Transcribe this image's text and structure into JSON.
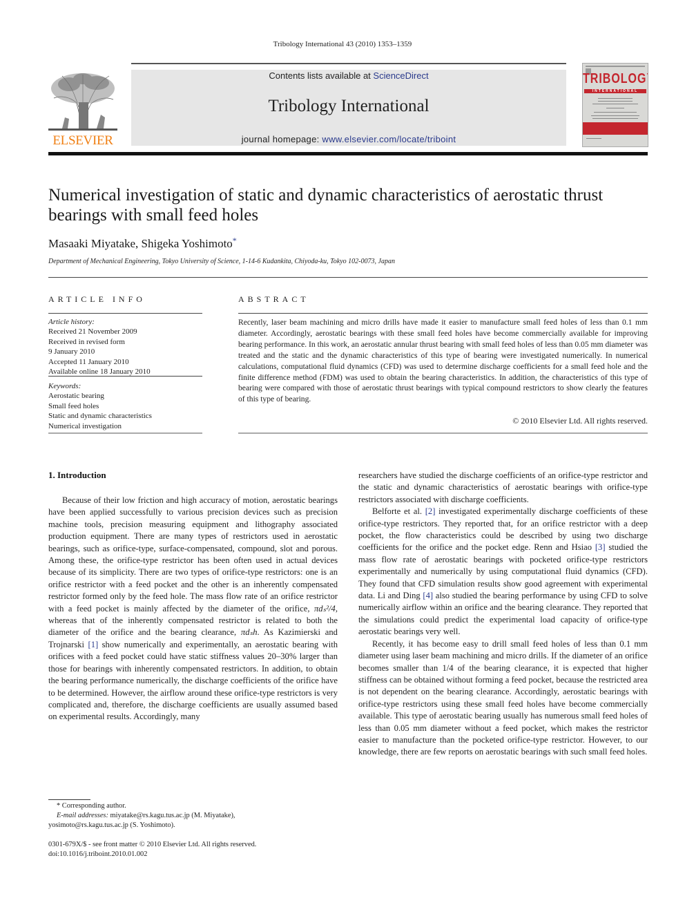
{
  "running_header": "Tribology International 43 (2010) 1353–1359",
  "masthead": {
    "contents_prefix": "Contents lists available at ",
    "contents_link": "ScienceDirect",
    "journal_title": "Tribology International",
    "homepage_prefix": "journal homepage: ",
    "homepage_link": "www.elsevier.com/locate/triboint",
    "publisher_logo_text": "ELSEVIER",
    "cover": {
      "title": "TRIBOLOGY",
      "subtitle": "INTERNATIONAL"
    },
    "colors": {
      "publisher_orange": "#f07f13",
      "link_blue": "#2a3a8c",
      "cover_red": "#c4262e",
      "masthead_grey": "#e6e6e6"
    }
  },
  "article": {
    "title": "Numerical investigation of static and dynamic characteristics of aerostatic thrust bearings with small feed holes",
    "authors": "Masaaki Miyatake, Shigeka Yoshimoto",
    "corresponding_mark": "*",
    "affiliation": "Department of Mechanical Engineering, Tokyo University of Science, 1-14-6 Kudankita, Chiyoda-ku, Tokyo 102-0073, Japan"
  },
  "article_info": {
    "label": "ARTICLE INFO",
    "history_label": "Article history:",
    "history": [
      "Received 21 November 2009",
      "Received in revised form",
      "9 January 2010",
      "Accepted 11 January 2010",
      "Available online 18 January 2010"
    ],
    "keywords_label": "Keywords:",
    "keywords": [
      "Aerostatic bearing",
      "Small feed holes",
      "Static and dynamic characteristics",
      "Numerical investigation"
    ]
  },
  "abstract": {
    "label": "ABSTRACT",
    "text": "Recently, laser beam machining and micro drills have made it easier to manufacture small feed holes of less than 0.1 mm diameter. Accordingly, aerostatic bearings with these small feed holes have become commercially available for improving bearing performance. In this work, an aerostatic annular thrust bearing with small feed holes of less than 0.05 mm diameter was treated and the static and the dynamic characteristics of this type of bearing were investigated numerically. In numerical calculations, computational fluid dynamics (CFD) was used to determine discharge coefficients for a small feed hole and the finite difference method (FDM) was used to obtain the bearing characteristics. In addition, the characteristics of this type of bearing were compared with those of aerostatic thrust bearings with typical compound restrictors to show clearly the features of this type of bearing.",
    "copyright": "© 2010 Elsevier Ltd. All rights reserved."
  },
  "body": {
    "section_heading": "1.  Introduction",
    "left": {
      "p1_a": "Because of their low friction and high accuracy of motion, aerostatic bearings have been applied successfully to various precision devices such as precision machine tools, precision measuring equipment and lithography associated production equipment. There are many types of restrictors used in aerostatic bearings, such as orifice-type, surface-compensated, compound, slot and porous. Among these, the orifice-type restrictor has been often used in actual devices because of its simplicity. There are two types of orifice-type restrictors: one is an orifice restrictor with a feed pocket and the other is an inherently compensated restrictor formed only by the feed hole. The mass flow rate of an orifice restrictor with a feed pocket is mainly affected by the diameter of the orifice, ",
      "math1": "πdₛ²/4",
      "p1_b": ", whereas that of the inherently compensated restrictor is related to both the diameter of the orifice and the bearing clearance, ",
      "math2": "πdₛh",
      "p1_c": ". As Kazimierski and Trojnarski ",
      "ref1": "[1]",
      "p1_d": " show numerically and experimentally, an aerostatic bearing with orifices with a feed pocket could have static stiffness values 20–30% larger than those for bearings with inherently compensated restrictors. In addition, to obtain the bearing performance numerically, the discharge coefficients of the orifice have to be determined. However, the airflow around these orifice-type restrictors is very complicated and, therefore, the discharge coefficients are usually assumed based on experimental results. Accordingly, many"
    },
    "right": {
      "p0": "researchers have studied the discharge coefficients of an orifice-type restrictor and the static and dynamic characteristics of aerostatic bearings with orifice-type restrictors associated with discharge coefficients.",
      "p2_a": "Belforte et al. ",
      "ref2": "[2]",
      "p2_b": " investigated experimentally discharge coefficients of these orifice-type restrictors. They reported that, for an orifice restrictor with a deep pocket, the flow characteristics could be described by using two discharge coefficients for the orifice and the pocket edge. Renn and Hsiao ",
      "ref3": "[3]",
      "p2_c": " studied the mass flow rate of aerostatic bearings with pocketed orifice-type restrictors experimentally and numerically by using computational fluid dynamics (CFD). They found that CFD simulation results show good agreement with experimental data. Li and Ding ",
      "ref4": "[4]",
      "p2_d": " also studied the bearing performance by using CFD to solve numerically airflow within an orifice and the bearing clearance. They reported that the simulations could predict the experimental load capacity of orifice-type aerostatic bearings very well.",
      "p3": "Recently, it has become easy to drill small feed holes of less than 0.1 mm diameter using laser beam machining and micro drills. If the diameter of an orifice becomes smaller than 1/4 of the bearing clearance, it is expected that higher stiffness can be obtained without forming a feed pocket, because the restricted area is not dependent on the bearing clearance. Accordingly, aerostatic bearings with orifice-type restrictors using these small feed holes have become commercially available. This type of aerostatic bearing usually has numerous small feed holes of less than 0.05 mm diameter without a feed pocket, which makes the restrictor easier to manufacture than the pocketed orifice-type restrictor. However, to our knowledge, there are few reports on aerostatic bearings with such small feed holes."
    }
  },
  "footnotes": {
    "corresponding": "* Corresponding author.",
    "email_label": "E-mail addresses:",
    "email_1": " miyatake@rs.kagu.tus.ac.jp (M. Miyatake),",
    "email_2": "yosimoto@rs.kagu.tus.ac.jp (S. Yoshimoto).",
    "front_matter": "0301-679X/$ - see front matter © 2010 Elsevier Ltd. All rights reserved.",
    "doi": "doi:10.1016/j.triboint.2010.01.002"
  }
}
